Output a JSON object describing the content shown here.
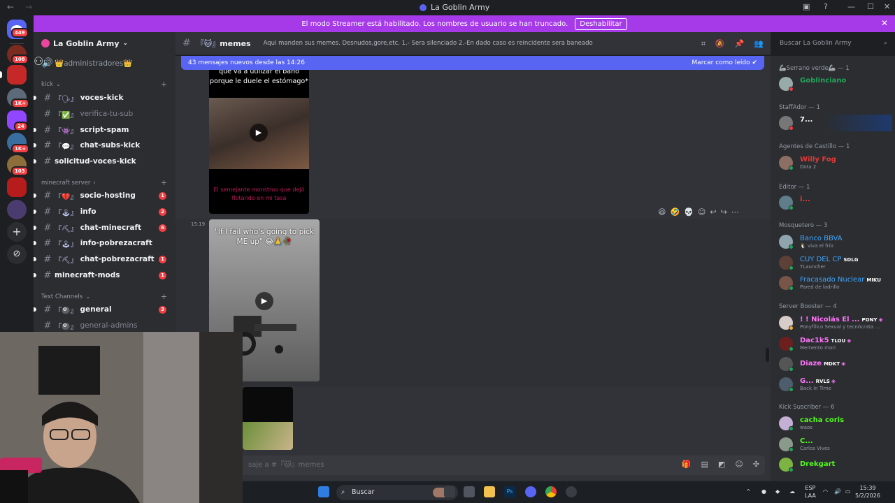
{
  "titlebar": {
    "title": "La Goblin Army",
    "back": "←",
    "forward": "→"
  },
  "server_rail": {
    "home_badge": "449",
    "badges": [
      "108",
      "1K+",
      "24",
      "1K+",
      "103"
    ]
  },
  "banner": {
    "text": "El modo Streamer está habilitado. Los nombres de usuario se han truncado.",
    "button": "Deshabilitar",
    "close": "✕"
  },
  "guild": {
    "name": "La Goblin Army"
  },
  "channels": {
    "top_item": "👑administradores👑",
    "categories": [
      {
        "name": "kick",
        "chevron": "⌄"
      },
      {
        "name": "minecraft server",
        "chevron": "›"
      },
      {
        "name": "Text Channels",
        "chevron": "⌄"
      }
    ],
    "items": [
      {
        "prefix": "『🗣』",
        "name": "voces-kick",
        "badge": "",
        "muted": false
      },
      {
        "prefix": "『✅』",
        "name": "verifica-tu-sub",
        "badge": "",
        "muted": true
      },
      {
        "prefix": "『👾』",
        "name": "script-spam",
        "badge": "",
        "muted": false
      },
      {
        "prefix": "『💬』",
        "name": "chat-subs-kick",
        "badge": "",
        "muted": false
      },
      {
        "prefix": "",
        "name": "solicitud-voces-kick",
        "badge": "",
        "muted": false
      },
      {
        "prefix": "『💔』",
        "name": "socio-hosting",
        "badge": "1",
        "muted": false
      },
      {
        "prefix": "『🕹』",
        "name": "info",
        "badge": "2",
        "muted": false
      },
      {
        "prefix": "『⛏』",
        "name": "chat-minecraft",
        "badge": "6",
        "muted": false
      },
      {
        "prefix": "『🕹』",
        "name": "info-pobrezacraft",
        "badge": "",
        "muted": false
      },
      {
        "prefix": "『⛏』",
        "name": "chat-pobrezacraft",
        "badge": "1",
        "muted": false
      },
      {
        "prefix": "",
        "name": "minecraft-mods",
        "badge": "1",
        "muted": false
      },
      {
        "prefix": "『🎱』",
        "name": "general",
        "badge": "3",
        "muted": false
      },
      {
        "prefix": "『🎱』",
        "name": "general-admins",
        "badge": "",
        "muted": true
      }
    ]
  },
  "channel_header": {
    "prefix": "『🐱』",
    "name": "memes",
    "topic": "Aqui manden sus memes. Desnudos,gore,etc. 1.- Sera silenciado 2.-En dado caso es reincidente sera baneado"
  },
  "search": {
    "placeholder": "Buscar La Goblin Army"
  },
  "new_messages": {
    "text": "43 mensajes nuevos desde las 14:26",
    "action": "Marcar como leído"
  },
  "messages": {
    "first_caption": "que va a utilizar el baño porque le duele el estómago*",
    "first_overlay": "El semejante monstruo que dejó flotando en mi tasa",
    "timestamp": "15:19",
    "second_caption": "\"If I fail who's going to pick ME up\" 😂🙏🥀"
  },
  "composer": {
    "placeholder": "Enviar mensaje a #『🐱』memes",
    "visible_part": "saje a #『🐱』memes"
  },
  "members": {
    "groups": [
      {
        "role": "🦾Serrano verde🦾 — 1",
        "members": [
          {
            "name": "Goblinciano",
            "status": "",
            "color": "#23a55a"
          }
        ]
      },
      {
        "role": "StaffAdor — 1",
        "members": [
          {
            "name": "7...",
            "status": "",
            "color": "#ffffff"
          }
        ]
      },
      {
        "role": "Agentes de Castillo — 1",
        "members": [
          {
            "name": "Willy Fog",
            "status": "Dota 2",
            "color": "#e53935"
          }
        ]
      },
      {
        "role": "Editor — 1",
        "members": [
          {
            "name": "i...",
            "status": "",
            "color": "#e53935"
          }
        ]
      },
      {
        "role": "Mosquetero — 3",
        "members": [
          {
            "name": "Banco BBVA",
            "status": "🐧 viva el frío",
            "color": "#3ea6ff"
          },
          {
            "name": "CUY DEL CP",
            "tag": "SDLG",
            "status": "TLauncher",
            "color": "#3ea6ff"
          },
          {
            "name": "Fracasado Nuclear",
            "tag": "MIKU",
            "status": "Pared de ladrillo",
            "color": "#3ea6ff"
          }
        ]
      },
      {
        "role": "Server Booster — 4",
        "members": [
          {
            "name": "! ! Nicolás El ...",
            "tag": "PONY",
            "status": "Ponyfílico Sexual y tecnócrata ...",
            "color": "#ff73fa"
          },
          {
            "name": "Dac1k5",
            "tag": "TLOU",
            "status": "Memento mori",
            "color": "#ff73fa"
          },
          {
            "name": "Diaze",
            "tag": "MDKT",
            "status": "",
            "color": "#ff73fa"
          },
          {
            "name": "G...",
            "tag": "RVLS",
            "status": "Back in Time",
            "color": "#ff73fa"
          }
        ]
      },
      {
        "role": "Kick Suscriber — 6",
        "members": [
          {
            "name": "cacha coris",
            "status": "waos",
            "color": "#53fc18"
          },
          {
            "name": "C...",
            "status": "Carlos Vives",
            "color": "#53fc18"
          },
          {
            "name": "Drekgart",
            "status": "",
            "color": "#53fc18"
          }
        ]
      }
    ]
  },
  "taskbar": {
    "search": "Buscar",
    "lang": "ESP",
    "region": "LAA",
    "time": "15:39",
    "date": "5/2/2026"
  },
  "colors": {
    "accent": "#5865f2",
    "banner": "#a639e8",
    "badge": "#f23f43"
  }
}
